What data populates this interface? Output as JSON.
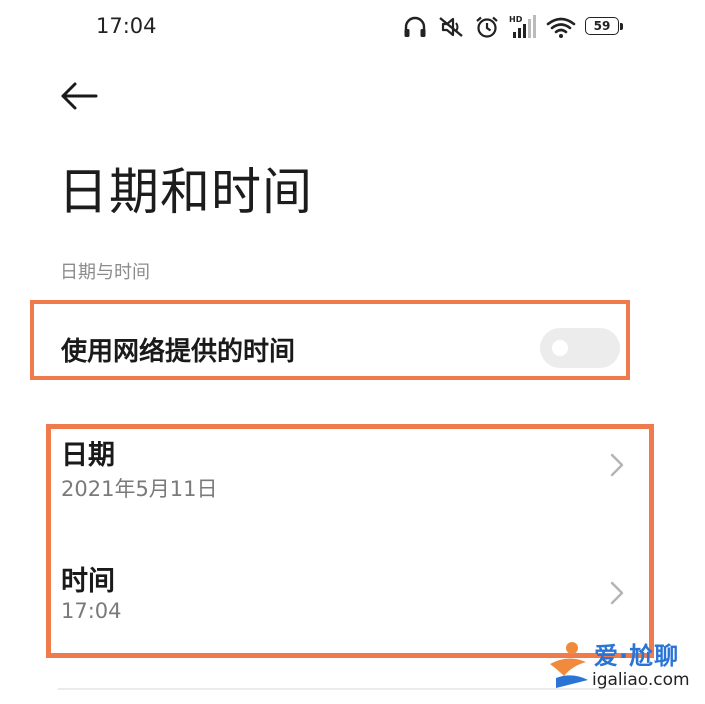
{
  "status_bar": {
    "time": "17:04",
    "battery_level": "59",
    "icons": [
      "headphones-icon",
      "muted-notification-icon",
      "alarm-icon",
      "hd-signal-icon",
      "wifi-icon",
      "battery-icon"
    ],
    "signal_label": "HD"
  },
  "header": {
    "back_icon": "arrow-left-icon",
    "title": "日期和时间"
  },
  "section": {
    "header": "日期与时间"
  },
  "network_time": {
    "label": "使用网络提供的时间",
    "enabled": false
  },
  "items": [
    {
      "title": "日期",
      "value": "2021年5月11日"
    },
    {
      "title": "时间",
      "value": "17:04"
    }
  ],
  "watermark": {
    "top_text": "爱·尬聊",
    "bottom_text": "igaliao.com"
  },
  "colors": {
    "highlight": "#ef7a4c",
    "toggle_off": "#ececec",
    "watermark_blue": "#2a74d6",
    "watermark_orange": "#f08a3c"
  }
}
